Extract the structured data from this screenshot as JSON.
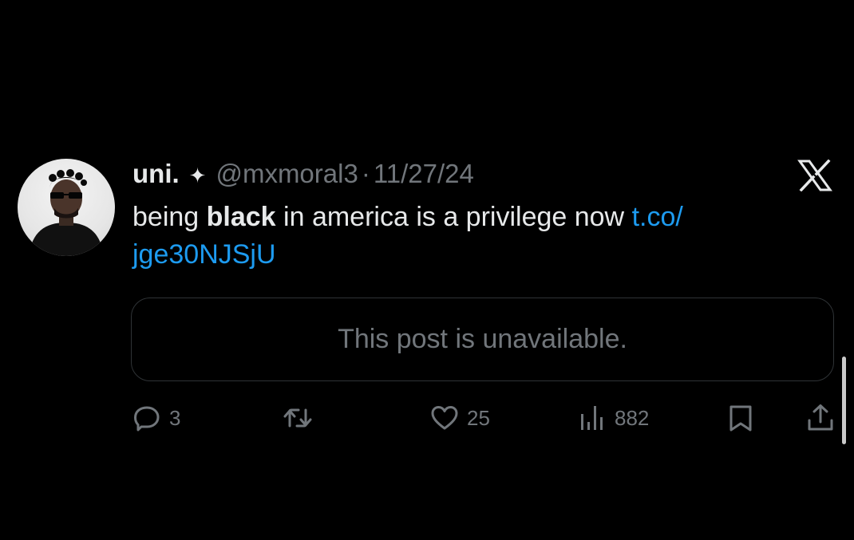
{
  "tweet": {
    "author": {
      "display_name": "uni.",
      "verified_glyph": "✦",
      "handle": "@mxmoral3",
      "separator": "·",
      "date": "11/27/24"
    },
    "text": {
      "before": "being ",
      "bold": "black",
      "after": " in america is a privilege now ",
      "link": "t.co/\njge30NJSjU"
    },
    "quote": {
      "message": "This post is unavailable."
    },
    "actions": {
      "reply_count": "3",
      "like_count": "25",
      "views_count": "882"
    }
  },
  "icons": {
    "logo": "x-logo",
    "reply": "reply-icon",
    "retweet": "retweet-icon",
    "like": "heart-icon",
    "views": "views-icon",
    "bookmark": "bookmark-icon",
    "share": "share-icon"
  },
  "colors": {
    "background": "#000000",
    "primary_text": "#e7e9ea",
    "secondary_text": "#71767b",
    "link": "#1d9bf0",
    "border": "#2f3336"
  }
}
